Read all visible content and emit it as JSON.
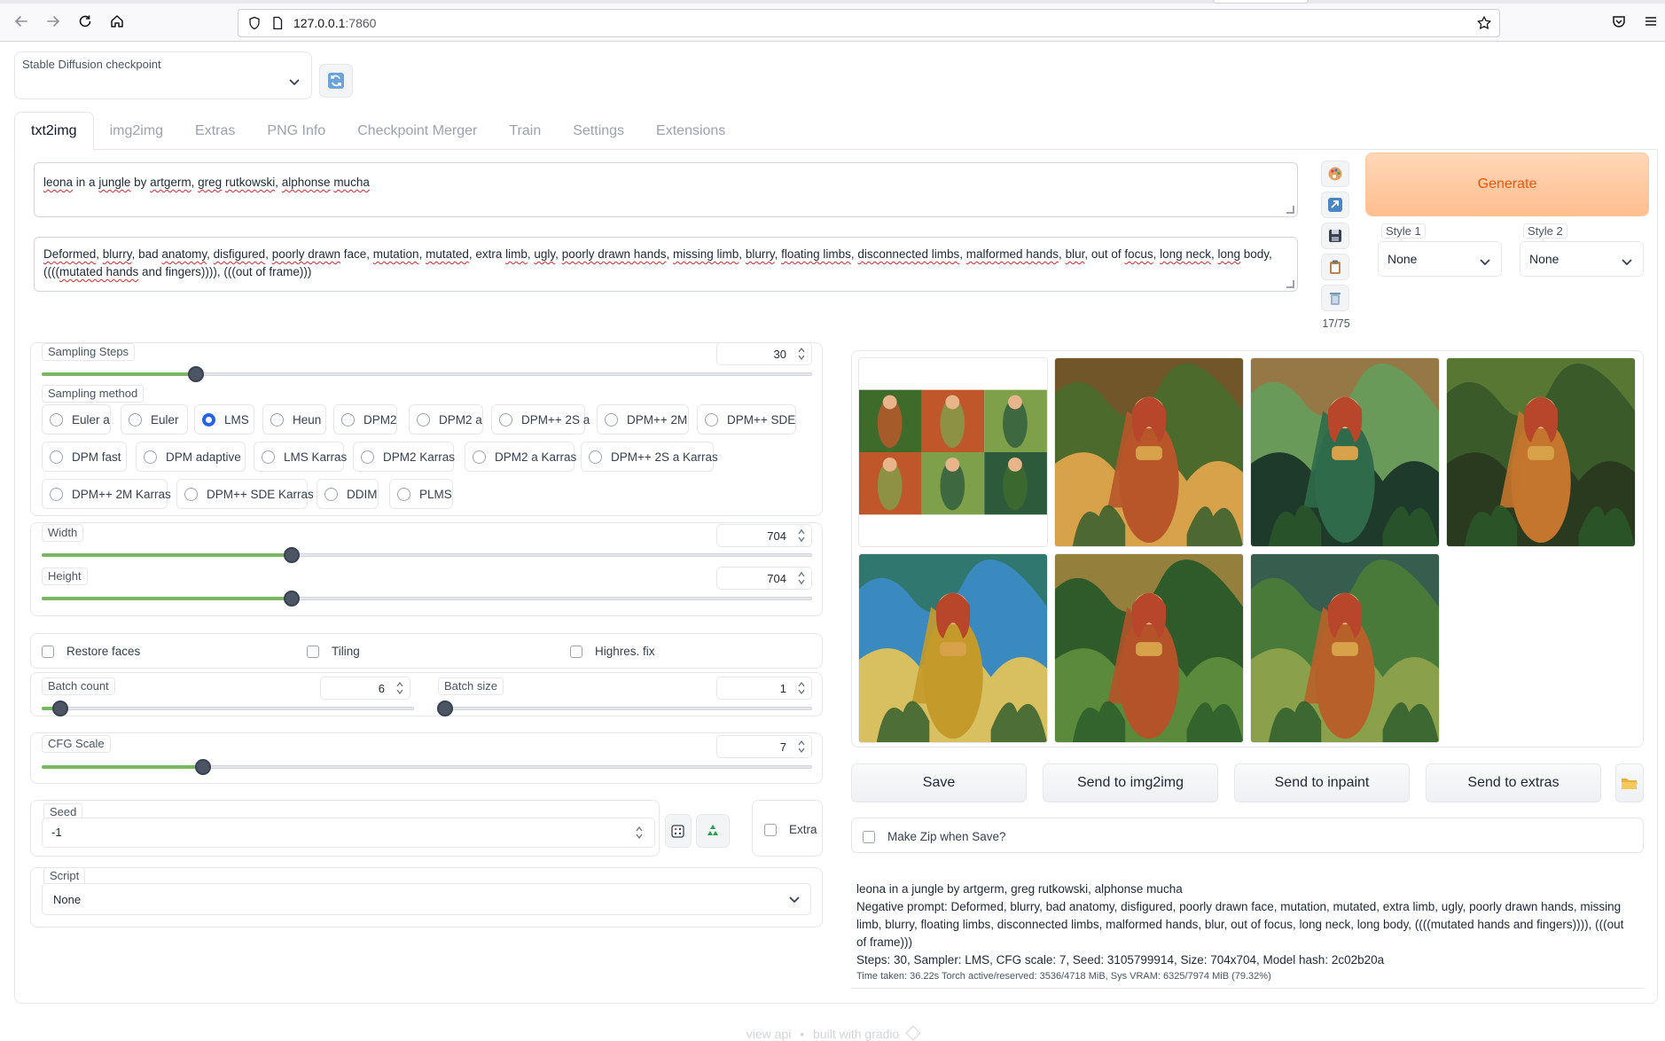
{
  "browser": {
    "url_host": "127.0.0.1",
    "url_port": ":7860"
  },
  "checkpoint": {
    "label": "Stable Diffusion checkpoint",
    "value": ""
  },
  "tabs": [
    "txt2img",
    "img2img",
    "Extras",
    "PNG Info",
    "Checkpoint Merger",
    "Train",
    "Settings",
    "Extensions"
  ],
  "prompt": {
    "positive_segments": [
      {
        "t": "leona",
        "s": true
      },
      {
        "t": " in a ",
        "s": false
      },
      {
        "t": "jungle",
        "s": true
      },
      {
        "t": " by ",
        "s": false
      },
      {
        "t": "artgerm",
        "s": true
      },
      {
        "t": ", ",
        "s": false
      },
      {
        "t": "greg",
        "s": true
      },
      {
        "t": " ",
        "s": false
      },
      {
        "t": "rutkowski",
        "s": true
      },
      {
        "t": ", ",
        "s": false
      },
      {
        "t": "alphonse",
        "s": true
      },
      {
        "t": " ",
        "s": false
      },
      {
        "t": "mucha",
        "s": true
      }
    ],
    "negative_segments": [
      {
        "t": "Deformed",
        "s": true
      },
      {
        "t": ", ",
        "s": false
      },
      {
        "t": "blurry",
        "s": true
      },
      {
        "t": ", bad ",
        "s": false
      },
      {
        "t": "anatomy",
        "s": true
      },
      {
        "t": ", ",
        "s": false
      },
      {
        "t": "disfigured",
        "s": true
      },
      {
        "t": ", ",
        "s": false
      },
      {
        "t": "poorly drawn",
        "s": true
      },
      {
        "t": " face, ",
        "s": false
      },
      {
        "t": "mutation",
        "s": true
      },
      {
        "t": ", ",
        "s": false
      },
      {
        "t": "mutated",
        "s": true
      },
      {
        "t": ", extra ",
        "s": false
      },
      {
        "t": "limb",
        "s": true
      },
      {
        "t": ", ",
        "s": false
      },
      {
        "t": "ugly",
        "s": true
      },
      {
        "t": ", ",
        "s": false
      },
      {
        "t": "poorly drawn hands",
        "s": true
      },
      {
        "t": ", ",
        "s": false
      },
      {
        "t": "missing limb",
        "s": true
      },
      {
        "t": ", ",
        "s": false
      },
      {
        "t": "blurry",
        "s": true
      },
      {
        "t": ", ",
        "s": false
      },
      {
        "t": "floating limbs",
        "s": true
      },
      {
        "t": ", ",
        "s": false
      },
      {
        "t": "disconnected limbs",
        "s": true
      },
      {
        "t": ", ",
        "s": false
      },
      {
        "t": "malformed hands",
        "s": true
      },
      {
        "t": ", ",
        "s": false
      },
      {
        "t": "blur",
        "s": true
      },
      {
        "t": ", out of ",
        "s": false
      },
      {
        "t": "focus",
        "s": true
      },
      {
        "t": ", ",
        "s": false
      },
      {
        "t": "long neck",
        "s": true
      },
      {
        "t": ", ",
        "s": false
      },
      {
        "t": "long",
        "s": true
      },
      {
        "t": " body,\n((((",
        "s": false
      },
      {
        "t": "mutated hands",
        "s": true
      },
      {
        "t": " and fingers)))), (((out of frame)))",
        "s": false
      }
    ]
  },
  "token_count": "17/75",
  "generate_label": "Generate",
  "styles": [
    {
      "label": "Style 1",
      "value": "None"
    },
    {
      "label": "Style 2",
      "value": "None"
    }
  ],
  "sampling": {
    "steps_label": "Sampling Steps",
    "steps_value": "30",
    "steps_fraction": 0.2,
    "method_label": "Sampling method",
    "methods": [
      "Euler a",
      "Euler",
      "LMS",
      "Heun",
      "DPM2",
      "DPM2 a",
      "DPM++ 2S a",
      "DPM++ 2M",
      "DPM++ SDE",
      "DPM fast",
      "DPM adaptive",
      "LMS Karras",
      "DPM2 Karras",
      "DPM2 a Karras",
      "DPM++ 2S a Karras",
      "DPM++ 2M Karras",
      "DPM++ SDE Karras",
      "DDIM",
      "PLMS"
    ],
    "selected": "LMS"
  },
  "size": {
    "width_label": "Width",
    "width_value": "704",
    "width_fraction": 0.325,
    "height_label": "Height",
    "height_value": "704",
    "height_fraction": 0.325
  },
  "options": {
    "restore_faces": "Restore faces",
    "tiling": "Tiling",
    "highres_fix": "Highres. fix"
  },
  "batch": {
    "count_label": "Batch count",
    "count_value": "6",
    "count_fraction": 0.05,
    "size_label": "Batch size",
    "size_value": "1",
    "size_fraction": 0.0
  },
  "cfg": {
    "label": "CFG Scale",
    "value": "7",
    "fraction": 0.21
  },
  "seed": {
    "label": "Seed",
    "value": "-1",
    "extra_label": "Extra"
  },
  "script": {
    "label": "Script",
    "value": "None"
  },
  "gallery_images": [
    {
      "name": "grid",
      "palette": [
        "#3f6b2a",
        "#c0572a",
        "#7ea04a",
        "#2e5a3c"
      ]
    },
    {
      "name": "img1",
      "palette": [
        "#4c6a2c",
        "#b8562a",
        "#8a4a2a",
        "#d8a24a"
      ]
    },
    {
      "name": "img2",
      "palette": [
        "#6a9a5a",
        "#2f6b4a",
        "#b4633a",
        "#1e3a2a"
      ]
    },
    {
      "name": "img3",
      "palette": [
        "#3a5a2a",
        "#c4762e",
        "#6a8a3a",
        "#2a3a1e"
      ]
    },
    {
      "name": "img4",
      "palette": [
        "#3a8ac0",
        "#c49a2a",
        "#2a6a3a",
        "#d8c060"
      ]
    },
    {
      "name": "img5",
      "palette": [
        "#2f5a2a",
        "#b4532a",
        "#d89a4a",
        "#5a8a3a"
      ]
    },
    {
      "name": "img6",
      "palette": [
        "#4a7a3a",
        "#b8602a",
        "#2a4a5a",
        "#8aa04a"
      ]
    }
  ],
  "actions": {
    "save": "Save",
    "send_img2img": "Send to img2img",
    "send_inpaint": "Send to inpaint",
    "send_extras": "Send to extras",
    "make_zip": "Make Zip when Save?"
  },
  "info": {
    "line1": "leona in a jungle by artgerm, greg rutkowski, alphonse mucha",
    "line2": "Negative prompt: Deformed, blurry, bad anatomy, disfigured, poorly drawn face, mutation, mutated, extra limb, ugly, poorly drawn hands, missing limb, blurry, floating limbs, disconnected limbs, malformed hands, blur, out of focus, long neck, long body, ((((mutated hands and fingers)))), (((out of frame)))",
    "line3": "Steps: 30, Sampler: LMS, CFG scale: 7, Seed: 3105799914, Size: 704x704, Model hash: 2c02b20a",
    "line4": "Time taken: 36.22s  Torch active/reserved: 3536/4718 MiB, Sys VRAM: 6325/7974 MiB (79.32%)"
  },
  "footer": {
    "view_api": "view api",
    "dot": "•",
    "built_with": "built with gradio"
  }
}
